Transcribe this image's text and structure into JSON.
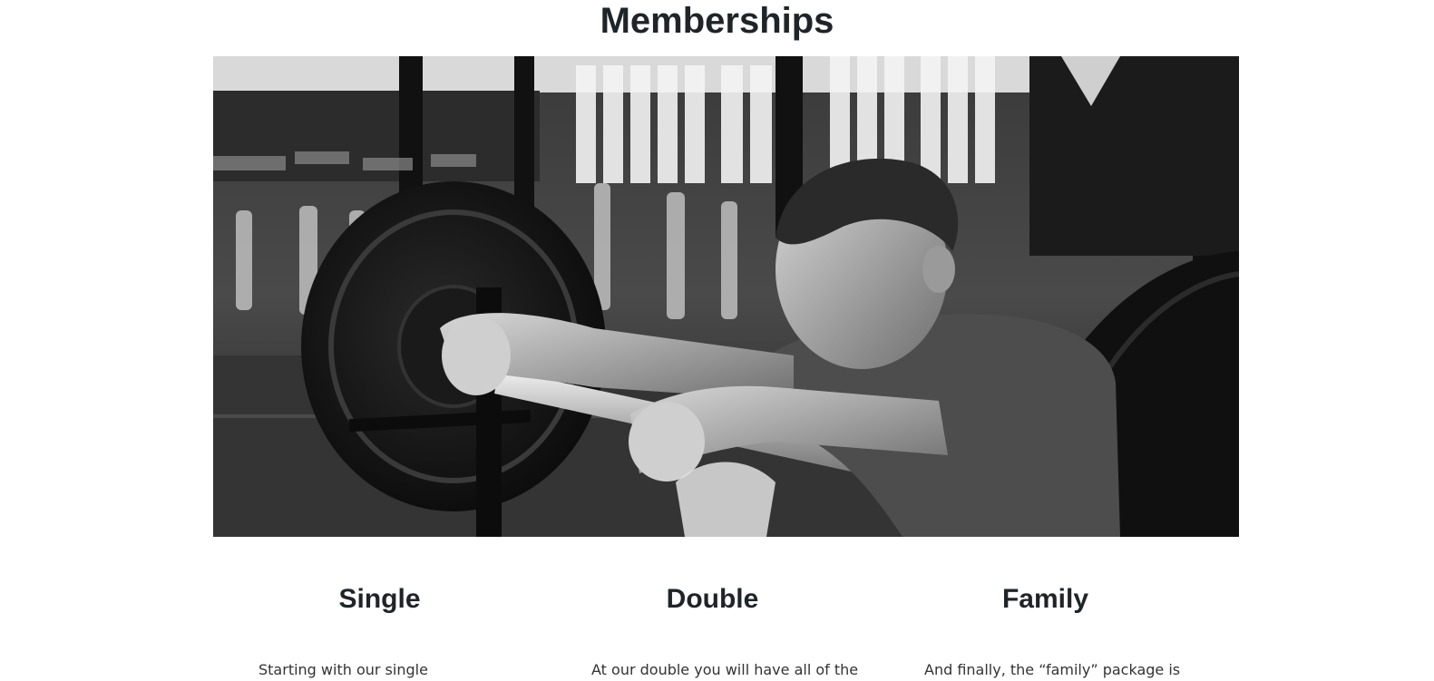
{
  "section": {
    "title": "Memberships"
  },
  "hero": {
    "alt": "Athlete resting on a loaded barbell in a gym",
    "style": "black-and-white photo"
  },
  "plans": [
    {
      "name": "Single",
      "description": "Starting with our single"
    },
    {
      "name": "Double",
      "description": "At our double you will have all of the"
    },
    {
      "name": "Family",
      "description": "And finally, the “family” package is"
    }
  ],
  "colors": {
    "text": "#1f2428",
    "body_text": "#333333",
    "background": "#ffffff"
  }
}
